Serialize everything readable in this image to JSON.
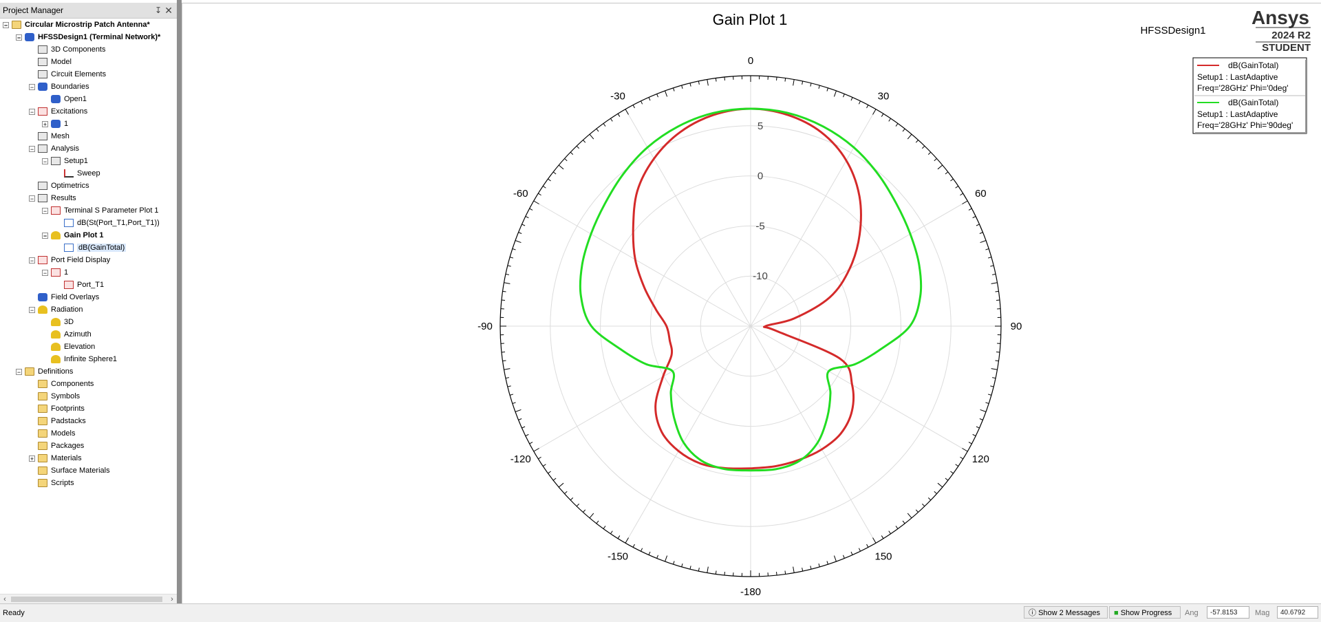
{
  "project_manager": {
    "title": "Project Manager",
    "tree": [
      {
        "label": "Circular Microstrip Patch Antenna*",
        "level": 0,
        "expander": "−",
        "icon": "project-icon",
        "bold": true
      },
      {
        "label": "HFSSDesign1 (Terminal Network)*",
        "level": 1,
        "expander": "−",
        "icon": "hfss-design-icon",
        "bold": true
      },
      {
        "label": "3D Components",
        "level": 2,
        "expander": "",
        "icon": "components-icon"
      },
      {
        "label": "Model",
        "level": 2,
        "expander": "",
        "icon": "model-icon"
      },
      {
        "label": "Circuit Elements",
        "level": 2,
        "expander": "",
        "icon": "circuit-elements-icon"
      },
      {
        "label": "Boundaries",
        "level": 2,
        "expander": "−",
        "icon": "boundaries-icon"
      },
      {
        "label": "Open1",
        "level": 3,
        "expander": "",
        "icon": "open-boundary-icon"
      },
      {
        "label": "Excitations",
        "level": 2,
        "expander": "−",
        "icon": "excitations-icon"
      },
      {
        "label": "1",
        "level": 3,
        "expander": "+",
        "icon": "port-icon"
      },
      {
        "label": "Mesh",
        "level": 2,
        "expander": "",
        "icon": "mesh-icon"
      },
      {
        "label": "Analysis",
        "level": 2,
        "expander": "−",
        "icon": "analysis-icon"
      },
      {
        "label": "Setup1",
        "level": 3,
        "expander": "−",
        "icon": "setup-icon"
      },
      {
        "label": "Sweep",
        "level": 4,
        "expander": "",
        "icon": "sweep-icon"
      },
      {
        "label": "Optimetrics",
        "level": 2,
        "expander": "",
        "icon": "optimetrics-icon"
      },
      {
        "label": "Results",
        "level": 2,
        "expander": "−",
        "icon": "results-icon"
      },
      {
        "label": "Terminal S Parameter Plot 1",
        "level": 3,
        "expander": "−",
        "icon": "rect-plot-icon"
      },
      {
        "label": "dB(St(Port_T1,Port_T1))",
        "level": 4,
        "expander": "",
        "icon": "trace-icon"
      },
      {
        "label": "Gain Plot 1",
        "level": 3,
        "expander": "−",
        "icon": "polar-plot-icon",
        "bold": true
      },
      {
        "label": "dB(GainTotal)",
        "level": 4,
        "expander": "",
        "icon": "trace-icon",
        "selected": true
      },
      {
        "label": "Port Field Display",
        "level": 2,
        "expander": "−",
        "icon": "port-field-icon"
      },
      {
        "label": "1",
        "level": 3,
        "expander": "−",
        "icon": "port-field-icon"
      },
      {
        "label": "Port_T1",
        "level": 4,
        "expander": "",
        "icon": "port-field-icon"
      },
      {
        "label": "Field Overlays",
        "level": 2,
        "expander": "",
        "icon": "field-overlays-icon"
      },
      {
        "label": "Radiation",
        "level": 2,
        "expander": "−",
        "icon": "radiation-icon"
      },
      {
        "label": "3D",
        "level": 3,
        "expander": "",
        "icon": "radiation-setup-icon"
      },
      {
        "label": "Azimuth",
        "level": 3,
        "expander": "",
        "icon": "radiation-setup-icon"
      },
      {
        "label": "Elevation",
        "level": 3,
        "expander": "",
        "icon": "radiation-setup-icon"
      },
      {
        "label": "Infinite Sphere1",
        "level": 3,
        "expander": "",
        "icon": "radiation-setup-icon"
      },
      {
        "label": "Definitions",
        "level": 1,
        "expander": "−",
        "icon": "folder-icon"
      },
      {
        "label": "Components",
        "level": 2,
        "expander": "",
        "icon": "folder-icon"
      },
      {
        "label": "Symbols",
        "level": 2,
        "expander": "",
        "icon": "folder-icon"
      },
      {
        "label": "Footprints",
        "level": 2,
        "expander": "",
        "icon": "folder-icon"
      },
      {
        "label": "Padstacks",
        "level": 2,
        "expander": "",
        "icon": "folder-icon"
      },
      {
        "label": "Models",
        "level": 2,
        "expander": "",
        "icon": "folder-icon"
      },
      {
        "label": "Packages",
        "level": 2,
        "expander": "",
        "icon": "folder-icon"
      },
      {
        "label": "Materials",
        "level": 2,
        "expander": "+",
        "icon": "folder-icon"
      },
      {
        "label": "Surface Materials",
        "level": 2,
        "expander": "",
        "icon": "folder-icon"
      },
      {
        "label": "Scripts",
        "level": 2,
        "expander": "",
        "icon": "folder-icon"
      }
    ]
  },
  "plot": {
    "title": "Gain Plot 1",
    "design_name": "HFSSDesign1",
    "brand": "Ansys",
    "version": "2024 R2",
    "edition": "STUDENT",
    "legend": [
      {
        "trace": "dB(GainTotal)",
        "line1": "Setup1 : LastAdaptive",
        "line2": "Freq='28GHz' Phi='0deg'",
        "color": "#d42a2a"
      },
      {
        "trace": "dB(GainTotal)",
        "line1": "Setup1 : LastAdaptive",
        "line2": "Freq='28GHz' Phi='90deg'",
        "color": "#22dd22"
      }
    ]
  },
  "chart_data": {
    "type": "polar",
    "title": "Gain Plot 1",
    "angle_ticks": [
      0,
      30,
      60,
      90,
      120,
      150,
      -180,
      -150,
      -120,
      -90,
      -60,
      -30
    ],
    "radial_ticks": [
      5.0,
      0.0,
      -5.0,
      -10.0
    ],
    "rlim": [
      -15,
      10
    ],
    "grid": true,
    "legend_position": "top-right",
    "series": [
      {
        "name": "dB(GainTotal) Setup1 : LastAdaptive Freq='28GHz' Phi='0deg'",
        "color": "#d42a2a",
        "theta": [
          -180,
          -170,
          -160,
          -150,
          -140,
          -130,
          -120,
          -110,
          -100,
          -90,
          -80,
          -70,
          -60,
          -50,
          -40,
          -30,
          -20,
          -10,
          0,
          10,
          20,
          30,
          40,
          50,
          60,
          70,
          80,
          90,
          100,
          110,
          120,
          130,
          140,
          150,
          160,
          170,
          180
        ],
        "values": [
          -0.8,
          -0.6,
          -0.4,
          -0.6,
          -1.2,
          -2.6,
          -4.9,
          -6.6,
          -6.8,
          -6.6,
          -5.4,
          -3.7,
          -1.7,
          0.3,
          2.6,
          4.3,
          5.6,
          6.4,
          6.7,
          6.4,
          5.6,
          4.1,
          1.9,
          -0.8,
          -3.6,
          -6.6,
          -10.6,
          -13.5,
          -12.5,
          -5.5,
          -3.3,
          -1.8,
          -1.0,
          -0.8,
          -0.8,
          -0.8,
          -0.8
        ]
      },
      {
        "name": "dB(GainTotal) Setup1 : LastAdaptive Freq='28GHz' Phi='90deg'",
        "color": "#22dd22",
        "theta": [
          -180,
          -170,
          -160,
          -150,
          -140,
          -130,
          -120,
          -110,
          -100,
          -90,
          -80,
          -70,
          -60,
          -50,
          -40,
          -30,
          -20,
          -10,
          0,
          10,
          20,
          30,
          40,
          50,
          60,
          70,
          80,
          90,
          100,
          110,
          120,
          130,
          140,
          150,
          160,
          170,
          180
        ],
        "values": [
          -0.6,
          -0.5,
          -0.7,
          -1.6,
          -3.1,
          -4.6,
          -6.0,
          -3.9,
          -1.8,
          0.9,
          2.2,
          2.9,
          3.4,
          4.0,
          4.8,
          5.6,
          6.2,
          6.6,
          6.7,
          6.6,
          6.2,
          5.6,
          4.8,
          4.0,
          3.4,
          2.9,
          2.2,
          0.9,
          -1.8,
          -3.9,
          -6.0,
          -4.6,
          -3.1,
          -1.6,
          -0.7,
          -0.5,
          -0.6
        ]
      }
    ]
  },
  "status": {
    "ready": "Ready",
    "messages_button": "Show 2 Messages",
    "progress_button": "Show Progress",
    "ang_label": "Ang",
    "ang_value": "-57.8153",
    "mag_label": "Mag",
    "mag_value": "40.6792"
  }
}
